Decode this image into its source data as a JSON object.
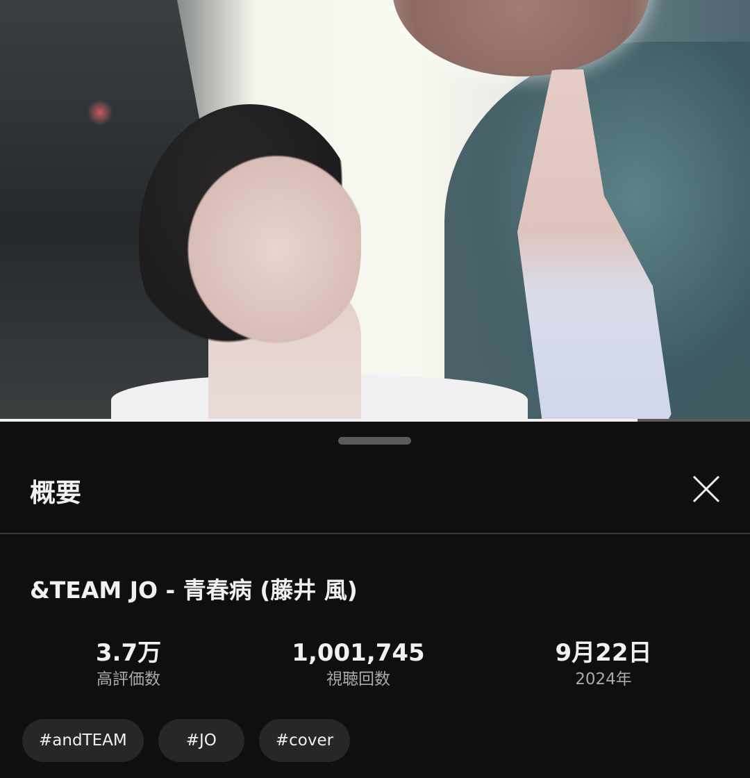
{
  "player": {
    "progress_fraction": 0.85
  },
  "sheet": {
    "title": "概要",
    "close_icon": "close-icon"
  },
  "video": {
    "title": "&TEAM JO - 青春病 (藤井 風)",
    "stats": [
      {
        "value": "3.7万",
        "label": "高評価数"
      },
      {
        "value": "1,001,745",
        "label": "視聴回数"
      },
      {
        "value": "9月22日",
        "label": "2024年"
      }
    ],
    "hashtags": [
      "#andTEAM",
      "#JO",
      "#cover"
    ]
  },
  "colors": {
    "background": "#0f0f0f",
    "chip_bg": "#272727",
    "secondary_text": "#aaaaaa"
  }
}
